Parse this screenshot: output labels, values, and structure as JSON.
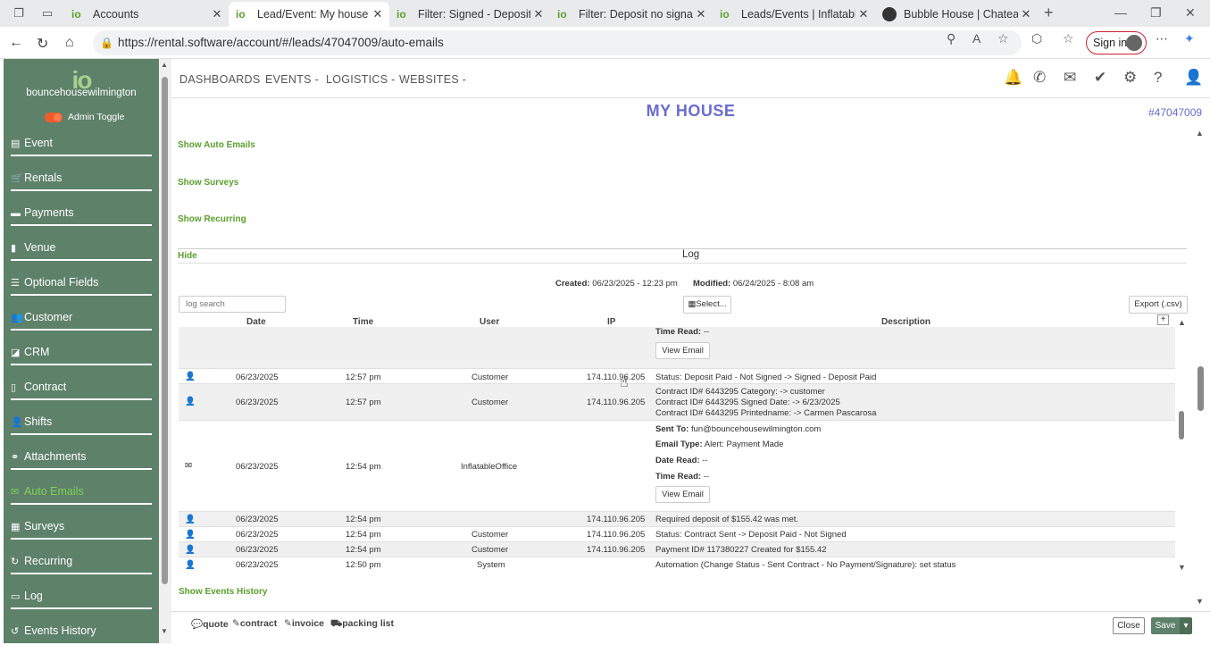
{
  "browser": {
    "tabs": [
      {
        "title": "Accounts",
        "favicon": "io"
      },
      {
        "title": "Lead/Event: My house | Infla",
        "favicon": "io",
        "active": true
      },
      {
        "title": "Filter: Signed - Deposit Paid",
        "favicon": "io"
      },
      {
        "title": "Filter: Deposit no signature",
        "favicon": "io"
      },
      {
        "title": "Leads/Events | InflatableOffi",
        "favicon": "io"
      },
      {
        "title": "Bubble House | Chateau Bou",
        "favicon": "globe"
      }
    ],
    "url": "https://rental.software/account/#/leads/47047009/auto-emails",
    "signin_label": "Sign in"
  },
  "sidebar": {
    "logo_mark": "io",
    "logo_name": "bouncehousewilmington",
    "admin_toggle": "Admin Toggle",
    "items": [
      {
        "label": "Event",
        "icon": "event-icon"
      },
      {
        "label": "Rentals",
        "icon": "cart-icon"
      },
      {
        "label": "Payments",
        "icon": "payment-icon"
      },
      {
        "label": "Venue",
        "icon": "building-icon"
      },
      {
        "label": "Optional Fields",
        "icon": "list-icon"
      },
      {
        "label": "Customer",
        "icon": "users-icon"
      },
      {
        "label": "CRM",
        "icon": "crm-icon"
      },
      {
        "label": "Contract",
        "icon": "document-icon"
      },
      {
        "label": "Shifts",
        "icon": "people-icon"
      },
      {
        "label": "Attachments",
        "icon": "paperclip-icon"
      },
      {
        "label": "Auto Emails",
        "icon": "envelope-icon",
        "active": true
      },
      {
        "label": "Surveys",
        "icon": "survey-icon"
      },
      {
        "label": "Recurring",
        "icon": "refresh-icon"
      },
      {
        "label": "Log",
        "icon": "log-icon"
      },
      {
        "label": "Events History",
        "icon": "history-icon"
      }
    ]
  },
  "topnav": {
    "items": [
      "DASHBOARDS",
      "EVENTS -",
      "LOGISTICS -",
      "WEBSITES -"
    ]
  },
  "page": {
    "title": "MY HOUSE",
    "lead_number": "#47047009",
    "links": {
      "auto_emails": "Show Auto Emails",
      "surveys": "Show Surveys",
      "recurring": "Show Recurring",
      "hide": "Hide",
      "events_history": "Show Events History"
    },
    "log_heading": "Log",
    "created_label": "Created:",
    "created_value": "06/23/2025 - 12:23 pm",
    "modified_label": "Modified:",
    "modified_value": "06/24/2025 - 8:08 am",
    "search_placeholder": "log search",
    "select_label": "Select...",
    "export_label": "Export (.csv)"
  },
  "log_table": {
    "headers": {
      "date": "Date",
      "time": "Time",
      "user": "User",
      "ip": "IP",
      "description": "Description"
    },
    "partial_top": {
      "time_read_label": "Time Read:",
      "time_read_value": "--",
      "button": "View Email"
    },
    "row1": {
      "date": "06/23/2025",
      "time": "12:57 pm",
      "user": "Customer",
      "ip": "174.110.96.205",
      "desc": "Status: Deposit Paid - Not Signed -> Signed - Deposit Paid"
    },
    "row2": {
      "date": "06/23/2025",
      "time": "12:57 pm",
      "user": "Customer",
      "ip": "174.110.96.205",
      "desc1": "Contract ID# 6443295 Category: -> customer",
      "desc2": "Contract ID# 6443295 Signed Date: -> 6/23/2025",
      "desc3": "Contract ID# 6443295 Printedname: -> Carmen Pascarosa"
    },
    "row3": {
      "date": "06/23/2025",
      "time": "12:54 pm",
      "user": "InflatableOffice",
      "sent_to_label": "Sent To:",
      "sent_to": "fun@bouncehousewilmington.com",
      "email_type_label": "Email Type:",
      "email_type": "Alert: Payment Made",
      "date_read_label": "Date Read:",
      "date_read": "--",
      "time_read_label": "Time Read:",
      "time_read": "--",
      "button": "View Email"
    },
    "row4": {
      "date": "06/23/2025",
      "time": "12:54 pm",
      "user": "",
      "ip": "174.110.96.205",
      "desc": "Required deposit of $155.42 was met."
    },
    "row5": {
      "date": "06/23/2025",
      "time": "12:54 pm",
      "user": "Customer",
      "ip": "174.110.96.205",
      "desc": "Status: Contract Sent -> Deposit Paid - Not Signed"
    },
    "row6": {
      "date": "06/23/2025",
      "time": "12:54 pm",
      "user": "Customer",
      "ip": "174.110.96.205",
      "desc": "Payment ID# 117380227 Created for $155.42"
    },
    "row7": {
      "date": "06/23/2025",
      "time": "12:50 pm",
      "user": "System",
      "ip": "",
      "desc": "Automation (Change Status - Sent Contract - No Payment/Signature): set status"
    }
  },
  "footer": {
    "quote": "quote",
    "contract": "contract",
    "invoice": "invoice",
    "packing_list": "packing list",
    "close": "Close",
    "save": "Save"
  },
  "colors": {
    "sidebar": "#5e8169",
    "accent_green": "#5aa02c",
    "title_purple": "#6b6bd0"
  }
}
